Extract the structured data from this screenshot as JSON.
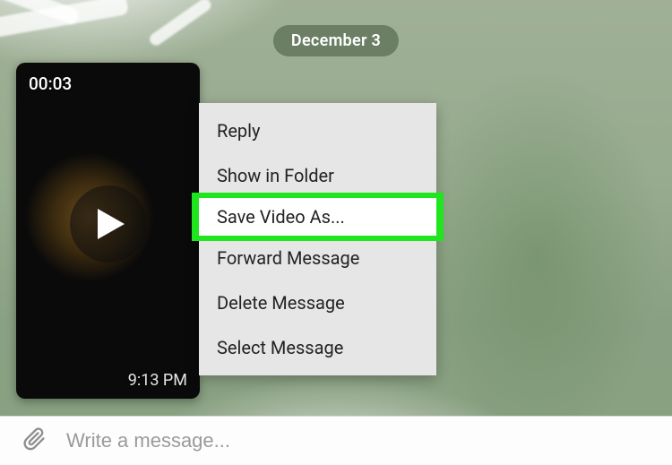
{
  "date_chip": "December 3",
  "video": {
    "duration": "00:03",
    "sent_time": "9:13 PM"
  },
  "context_menu": {
    "reply": "Reply",
    "show_in_folder": "Show in Folder",
    "save_video_as": "Save Video As...",
    "forward_message": "Forward Message",
    "delete_message": "Delete Message",
    "select_message": "Select Message"
  },
  "composer": {
    "placeholder": "Write a message..."
  }
}
